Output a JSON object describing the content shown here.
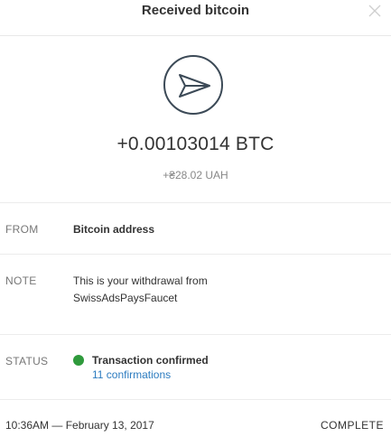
{
  "header": {
    "title": "Received bitcoin",
    "close_icon": "close-icon"
  },
  "transaction": {
    "icon": "send-arrow-icon",
    "amount": "+0.00103014 BTC",
    "fiat_amount": "+₴28.02 UAH"
  },
  "details": {
    "from_label": "FROM",
    "from_value": "Bitcoin address",
    "note_label": "NOTE",
    "note_value": "This is your withdrawal from SwissAdsPaysFaucet",
    "status_label": "STATUS",
    "status_value": "Transaction confirmed",
    "status_color": "#2f9a3c",
    "confirmations": "11 confirmations"
  },
  "footer": {
    "datetime": "10:36AM — February 13, 2017",
    "state": "COMPLETE"
  },
  "colors": {
    "link": "#2d7cc0",
    "icon_stroke": "#3c4a57"
  }
}
